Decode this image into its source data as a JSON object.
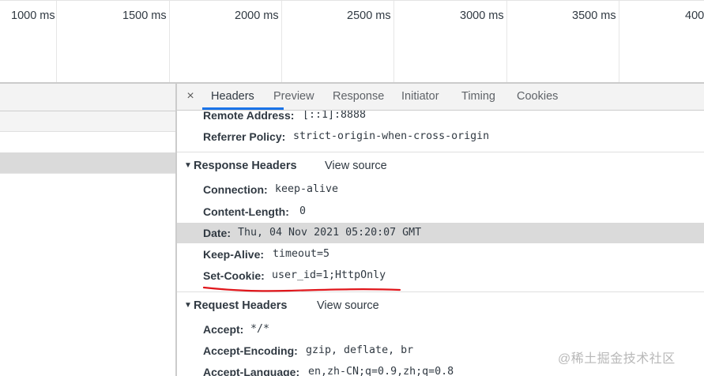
{
  "timeline": {
    "ticks": [
      "1000 ms",
      "1500 ms",
      "2000 ms",
      "2500 ms",
      "3000 ms",
      "3500 ms",
      "400"
    ]
  },
  "tabs": {
    "close_symbol": "×",
    "items": [
      "Headers",
      "Preview",
      "Response",
      "Initiator",
      "Timing",
      "Cookies"
    ],
    "active": "Headers"
  },
  "general": {
    "remote_address": {
      "name": "Remote Address:",
      "value": "[::1]:8888"
    },
    "referrer_policy": {
      "name": "Referrer Policy:",
      "value": "strict-origin-when-cross-origin"
    }
  },
  "response_headers": {
    "title": "Response Headers",
    "view_source": "View source",
    "items": [
      {
        "name": "Connection:",
        "value": "keep-alive"
      },
      {
        "name": "Content-Length:",
        "value": "0"
      },
      {
        "name": "Date:",
        "value": "Thu, 04 Nov 2021 05:20:07 GMT"
      },
      {
        "name": "Keep-Alive:",
        "value": "timeout=5"
      },
      {
        "name": "Set-Cookie:",
        "value": "user_id=1;HttpOnly"
      }
    ]
  },
  "request_headers": {
    "title": "Request Headers",
    "view_source": "View source",
    "items": [
      {
        "name": "Accept:",
        "value": "*/*"
      },
      {
        "name": "Accept-Encoding:",
        "value": "gzip, deflate, br"
      },
      {
        "name": "Accept-Language:",
        "value": "en,zh-CN;q=0.9,zh;q=0.8"
      }
    ]
  },
  "watermark": "@稀土掘金技术社区",
  "colors": {
    "accent": "#1a73e8",
    "annotation": "#e0161b",
    "highlight": "#dadada"
  }
}
